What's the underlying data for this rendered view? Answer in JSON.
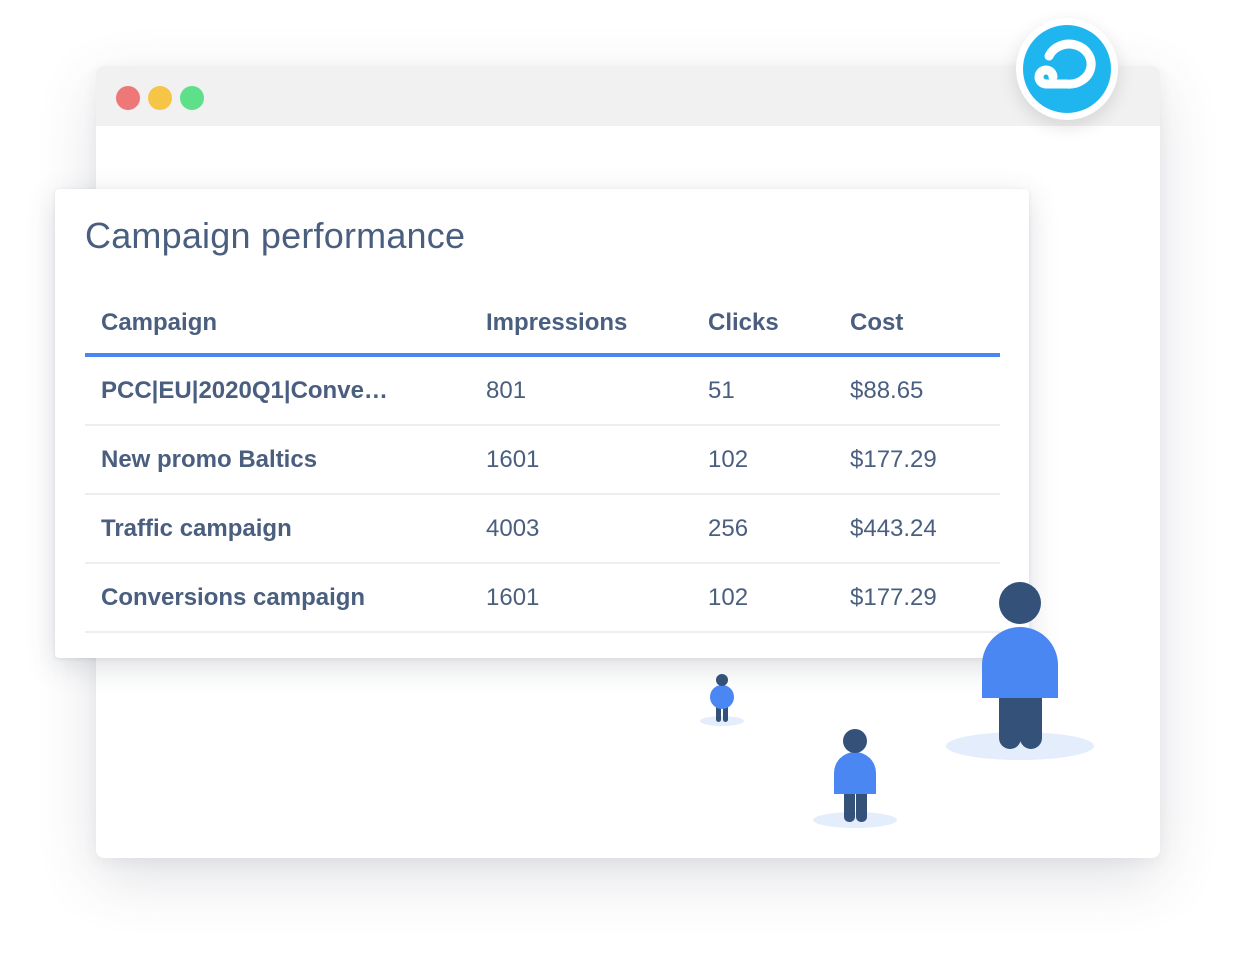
{
  "card": {
    "title": "Campaign performance"
  },
  "table": {
    "columns": [
      "Campaign",
      "Impressions",
      "Clicks",
      "Cost"
    ],
    "rows": [
      [
        "PCC|EU|2020Q1|Conve…",
        "801",
        "51",
        "$88.65"
      ],
      [
        "New promo Baltics",
        "1601",
        "102",
        "$177.29"
      ],
      [
        "Traffic campaign",
        "4003",
        "256",
        "$443.24"
      ],
      [
        "Conversions campaign",
        "1601",
        "102",
        "$177.29"
      ]
    ]
  },
  "colors": {
    "accent": "#4b87f2",
    "text": "#4a5f7f",
    "logo": "#1fb6f0",
    "person_body": "#4b87f2",
    "person_dark": "#34517a",
    "shadow": "#e3edfb",
    "traffic_red": "#ee7777",
    "traffic_yellow": "#f6c548",
    "traffic_green": "#5ee08a"
  },
  "icons": {
    "logo": "brand-logo-icon",
    "people": "person-icon"
  }
}
